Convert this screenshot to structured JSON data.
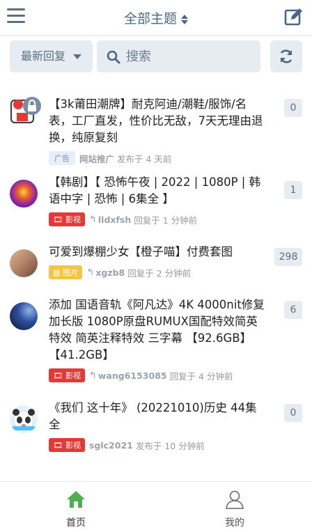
{
  "header": {
    "title": "全部主题"
  },
  "toolbar": {
    "sort_label": "最新回复",
    "search_placeholder": "搜索"
  },
  "topics": [
    {
      "title": "【3k莆田潮牌】耐克阿迪/潮鞋/服饰/名表，工厂直发，性价比无敌，7天无理由退换，纯原复刻",
      "tag": "广告",
      "author": "网站推广",
      "time_text": "发布于 4 天前",
      "count": "0"
    },
    {
      "title": "【韩剧】【 恐怖午夜 | 2022 | 1080P | 韩语中字 | 恐怖 | 6集全 】",
      "tag": "影视",
      "author": "lldxfsh",
      "time_text": "回复于 1 分钟前",
      "count": "1"
    },
    {
      "title": "可爱到爆棚少女【橙子喵】付费套图",
      "tag": "图片",
      "author": "xgzb8",
      "time_text": "回复于 2 分钟前",
      "count": "298"
    },
    {
      "title": "添加 国语音轨《阿凡达》4K 4000nit修复 加长版 1080P原盘RUMUX国配特效简英特效 简英注释特效 三字幕 【92.6GB】【41.2GB】",
      "tag": "影视",
      "author": "wang6153085",
      "time_text": "回复于 4 分钟前",
      "count": "6"
    },
    {
      "title": "《我们 这十年》 (20221010)历史 44集全",
      "tag": "影视",
      "author": "sglc2021",
      "time_text": "发布于 10 分钟前",
      "count": "0"
    }
  ],
  "tabbar": {
    "home_label": "首页",
    "mine_label": "我的"
  },
  "colors": {
    "accent": "#4a6684",
    "tag_video": "#e53935",
    "tag_image": "#f4c542",
    "home_active": "#4caf50"
  }
}
